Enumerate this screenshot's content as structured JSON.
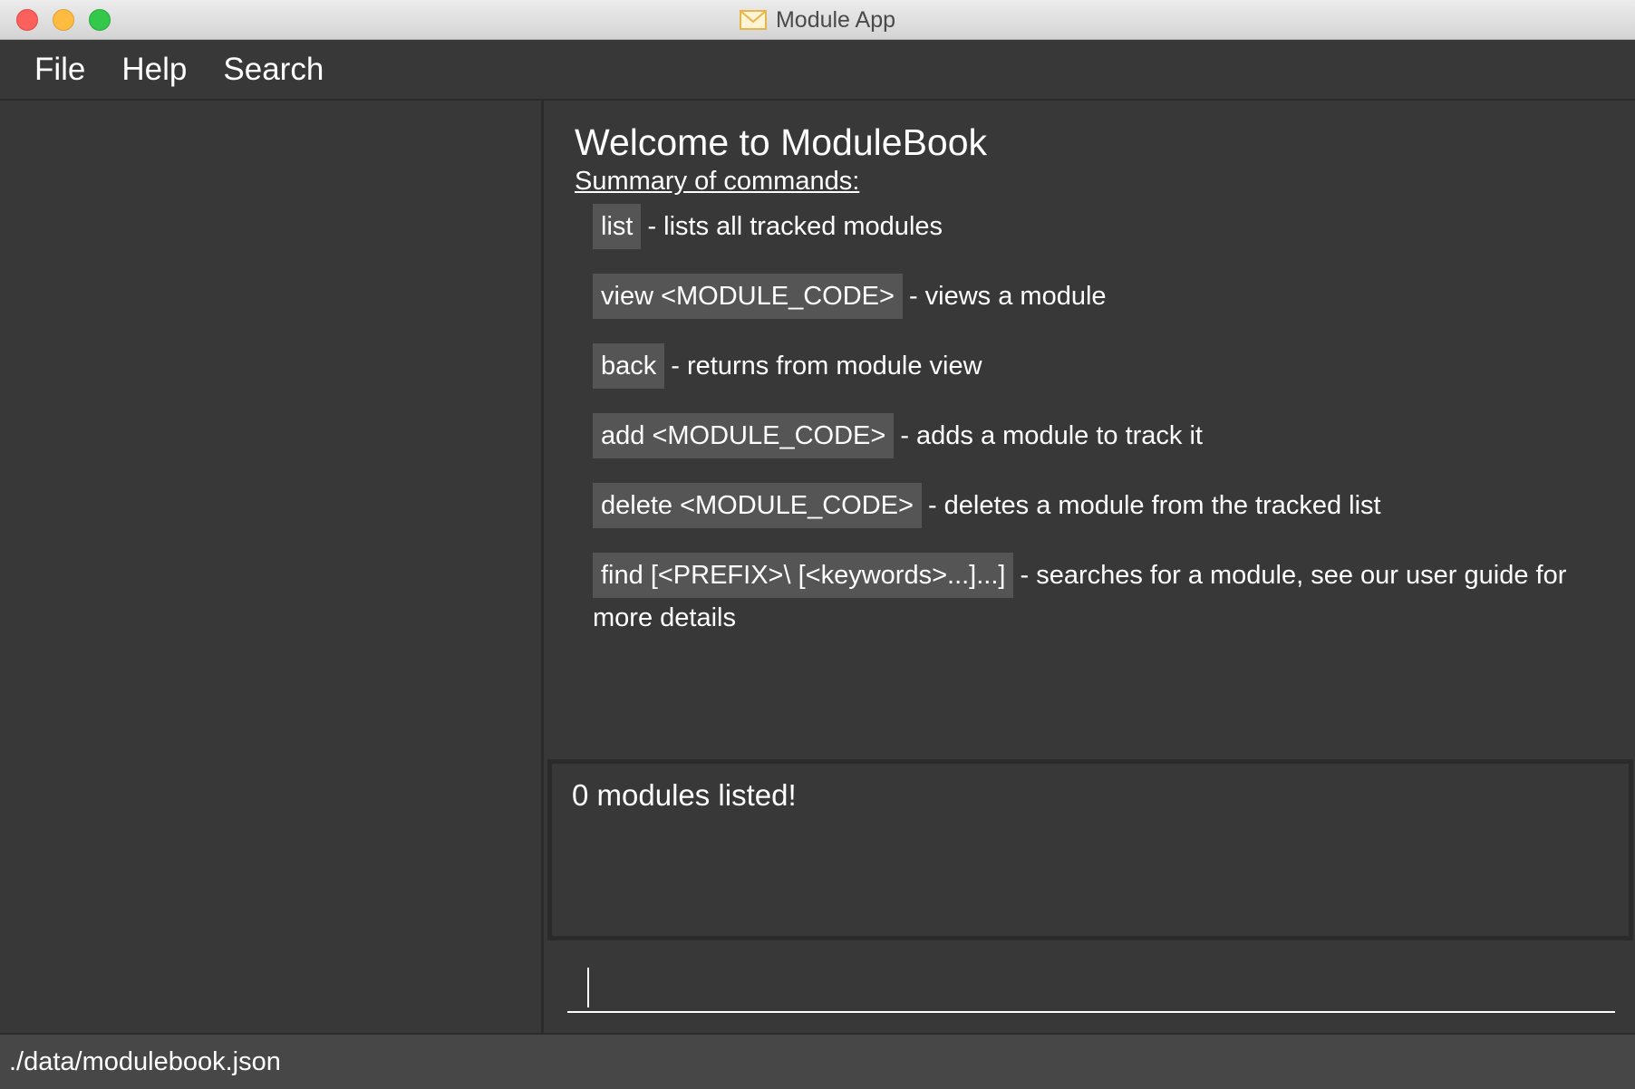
{
  "window": {
    "title": "Module App",
    "icon": "envelope-icon",
    "controls": [
      "close",
      "minimize",
      "maximize"
    ]
  },
  "menu": {
    "items": [
      {
        "label": "File"
      },
      {
        "label": "Help"
      },
      {
        "label": "Search"
      }
    ]
  },
  "help": {
    "title": "Welcome to ModuleBook",
    "summary": "Summary of commands:",
    "commands": [
      {
        "code": "list",
        "desc": "- lists all tracked modules"
      },
      {
        "code": "view <MODULE_CODE>",
        "desc": "- views a module"
      },
      {
        "code": "back",
        "desc": "- returns from module view"
      },
      {
        "code": "add <MODULE_CODE>",
        "desc": "- adds a module to track it"
      },
      {
        "code": "delete <MODULE_CODE>",
        "desc": "- deletes a module from the tracked list"
      },
      {
        "code": "find [<PREFIX>\\ [<keywords>...]...]",
        "desc": "- searches for a module, see our user guide for more details"
      }
    ]
  },
  "result": {
    "text": "0 modules listed!"
  },
  "command_box": {
    "value": "",
    "placeholder": ""
  },
  "status": {
    "file_path": "./data/modulebook.json"
  },
  "colors": {
    "background": "#383838",
    "border": "#2b2b2b",
    "code_bg": "#555555",
    "status_bg": "#474747",
    "text": "#ffffff"
  }
}
